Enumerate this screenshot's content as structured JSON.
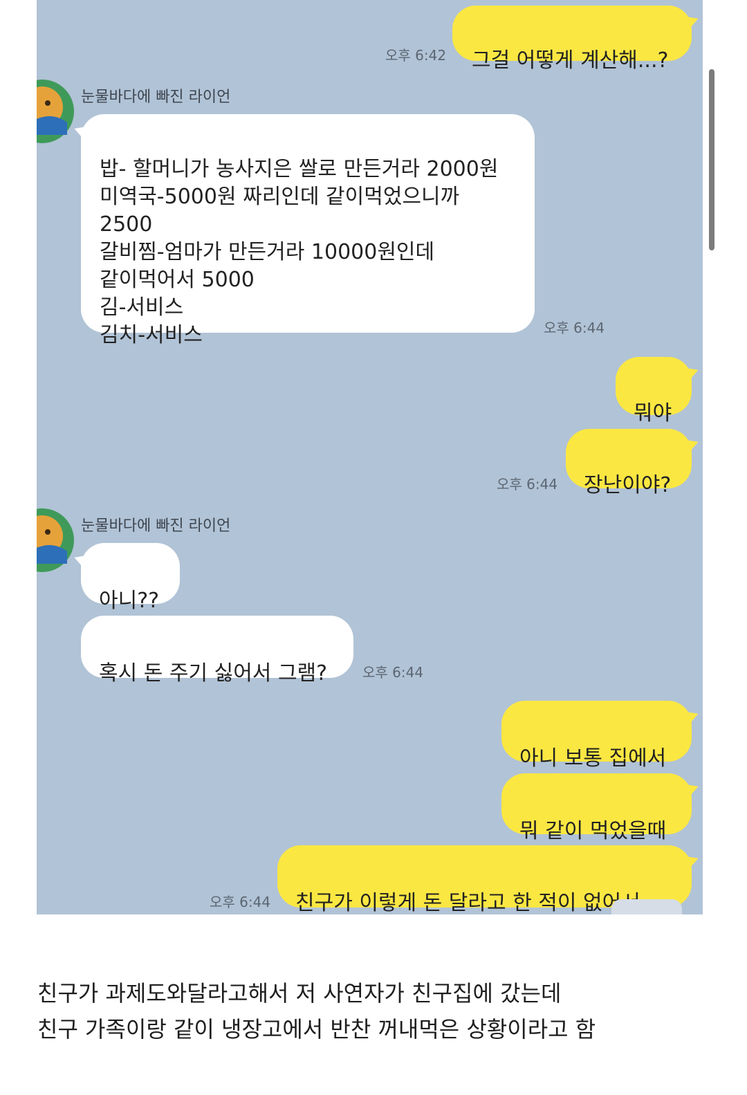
{
  "chat": {
    "sender_name": "눈물바다에 빠진 라이언",
    "messages": [
      {
        "id": "m1",
        "side": "me",
        "text": "그걸 어떻게 계산해...?",
        "time": "오후 6:42"
      },
      {
        "id": "m2",
        "side": "them",
        "text": "밥- 할머니가 농사지은 쌀로 만든거라 2000원\n미역국-5000원 짜리인데 같이먹었으니까\n2500\n갈비찜-엄마가 만든거라 10000원인데\n같이먹어서 5000\n김-서비스\n김치-서비스",
        "time": "오후 6:44"
      },
      {
        "id": "m3",
        "side": "me",
        "text": "뭐야",
        "time": ""
      },
      {
        "id": "m4",
        "side": "me",
        "text": "장난이야?",
        "time": "오후 6:44"
      },
      {
        "id": "m5",
        "side": "them",
        "text": "아니??",
        "time": ""
      },
      {
        "id": "m6",
        "side": "them",
        "text": "혹시 돈 주기 싫어서 그램?",
        "time": "오후 6:44"
      },
      {
        "id": "m7",
        "side": "me",
        "text": "아니 보통 집에서",
        "time": ""
      },
      {
        "id": "m8",
        "side": "me",
        "text": "뭐 같이 먹었을때",
        "time": ""
      },
      {
        "id": "m9",
        "side": "me",
        "text": "친구가 이렇게 돈 달라고 한 적이 없어서...",
        "time": "오후 6:44"
      }
    ]
  },
  "caption": {
    "line1": "친구가 과제도와달라고해서 저 사연자가 친구집에 갔는데",
    "line2": "친구 가족이랑 같이 냉장고에서 반찬 꺼내먹은 상황이라고 함"
  },
  "colors": {
    "chat_background": "#b1c3d6",
    "my_bubble": "#fbe742",
    "their_bubble": "#ffffff"
  },
  "icons": {
    "avatar": "ryan-avatar-icon"
  }
}
